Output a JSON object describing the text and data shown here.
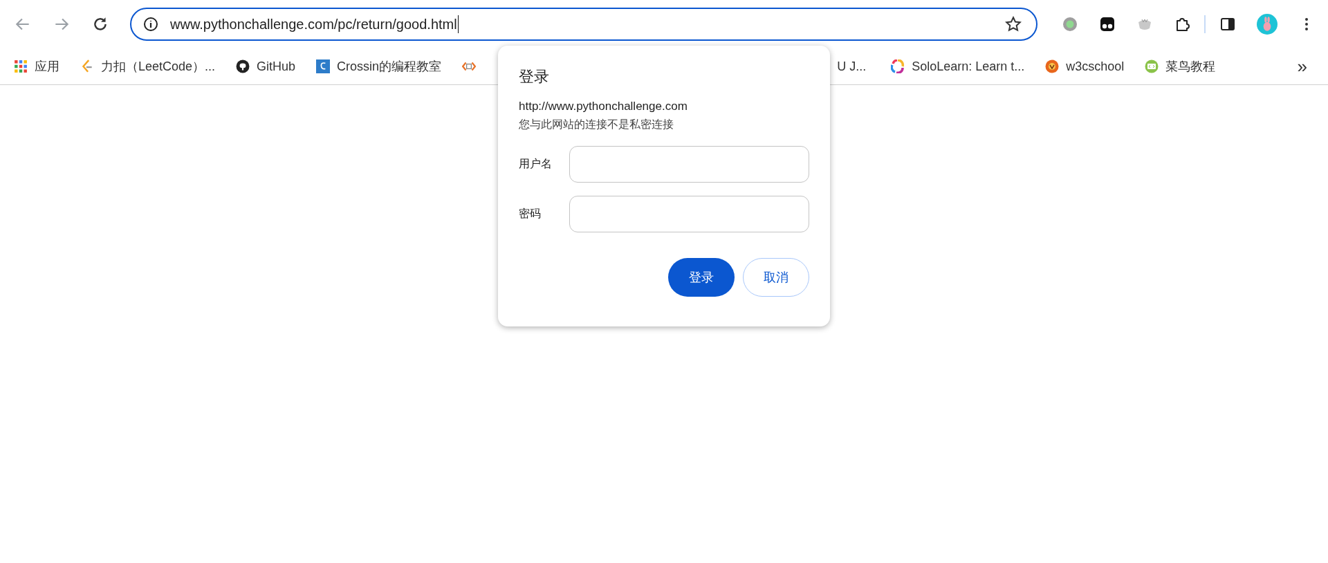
{
  "address_bar": {
    "url": "www.pythonchallenge.com/pc/return/good.html",
    "focused": true
  },
  "bookmarks": [
    {
      "label": "应用"
    },
    {
      "label": "力扣（LeetCode）..."
    },
    {
      "label": "GitHub"
    },
    {
      "label": "Crossin的编程教室"
    },
    {
      "kind": "icon_only"
    },
    {
      "label": "U J..."
    },
    {
      "label": "SoloLearn: Learn t..."
    },
    {
      "label": "w3cschool"
    },
    {
      "label": "菜鸟教程"
    }
  ],
  "overflow": "»",
  "dialog": {
    "title": "登录",
    "origin": "http://www.pythonchallenge.com",
    "warning": "您与此网站的连接不是私密连接",
    "fields": [
      {
        "label": "用户名"
      },
      {
        "label": "密码"
      }
    ],
    "buttons": [
      {
        "label": "登录",
        "kind": "primary"
      },
      {
        "label": "取消",
        "kind": "secondary"
      }
    ]
  }
}
